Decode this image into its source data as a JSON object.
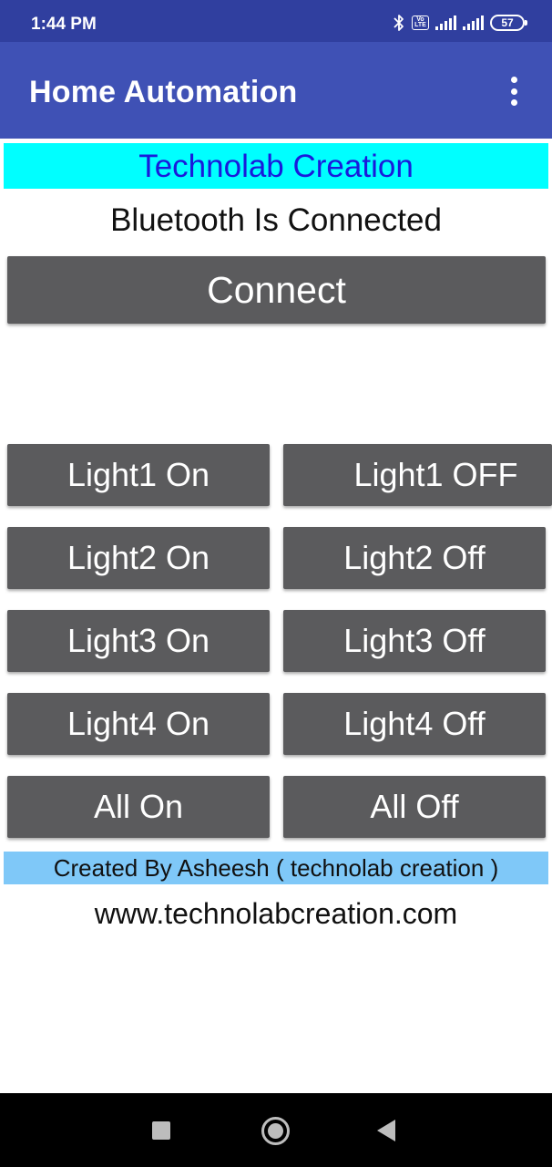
{
  "status_bar": {
    "time": "1:44 PM",
    "volte_label": "Vo LTE",
    "battery_level": "57",
    "icons": [
      "bluetooth-icon",
      "volte-icon",
      "signal-icon",
      "signal-icon",
      "battery-icon"
    ]
  },
  "app_bar": {
    "title": "Home Automation",
    "menu_icon": "overflow-menu-icon"
  },
  "banner": {
    "text": "Technolab Creation",
    "background": "#00ffff",
    "text_color": "#1a1adb"
  },
  "connection": {
    "status_text": "Bluetooth Is Connected",
    "connect_label": "Connect"
  },
  "controls": {
    "light1_on": "Light1 On",
    "light1_off": "Light1 OFF",
    "light2_on": "Light2 On",
    "light2_off": "Light2 Off",
    "light3_on": "Light3 On",
    "light3_off": "Light3 Off",
    "light4_on": "Light4 On",
    "light4_off": "Light4 Off",
    "all_on": "All On",
    "all_off": "All Off"
  },
  "footer": {
    "credit": "Created By Asheesh ( technolab creation )",
    "credit_background": "#7fc8f8",
    "website": "www.technolabcreation.com"
  },
  "nav_bar": {
    "icons": [
      "recent-apps-icon",
      "home-icon",
      "back-icon"
    ]
  },
  "colors": {
    "status_bar": "#303f9f",
    "app_bar": "#3f51b5",
    "button": "#5b5b5d"
  }
}
